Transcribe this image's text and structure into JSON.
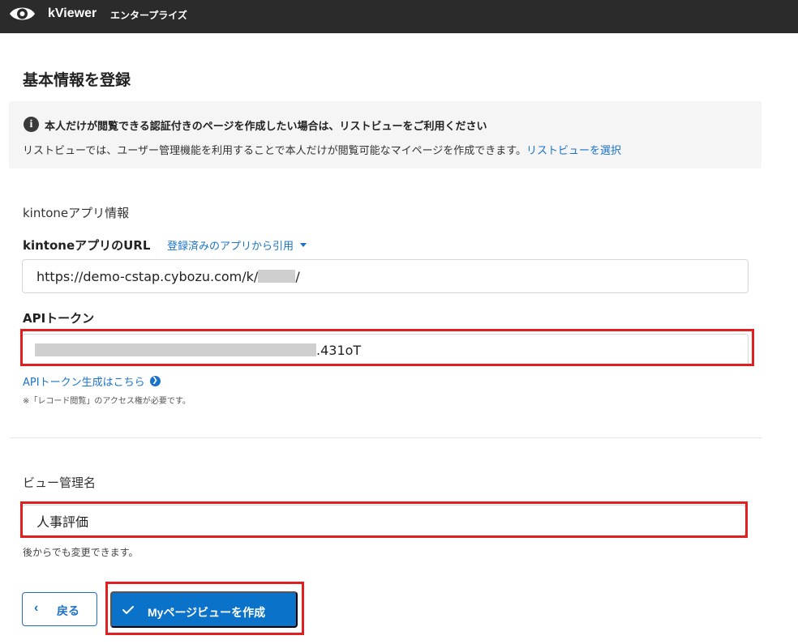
{
  "app": {
    "name": "kViewer",
    "edition": "エンタープライズ"
  },
  "page": {
    "title": "基本情報を登録"
  },
  "notice": {
    "title": "本人だけが閲覧できる認証付きのページを作成したい場合は、リストビューをご利用ください",
    "body": "リストビューでは、ユーザー管理機能を利用することで本人だけが閲覧可能なマイページを作成できます。",
    "link": "リストビューを選択"
  },
  "kintone": {
    "section_label": "kintoneアプリ情報",
    "url_label": "kintoneアプリのURL",
    "url_link": "登録済みのアプリから引用",
    "url_value_prefix": "https://demo-cstap.cybozu.com/k/",
    "url_value_suffix": "/",
    "token_label": "APIトークン",
    "token_value_suffix": ".431oT",
    "token_link": "APIトークン生成はこちら",
    "token_note": "※「レコード閲覧」のアクセス権が必要です。"
  },
  "view": {
    "label": "ビュー管理名",
    "value": "人事評価",
    "note": "後からでも変更できます。"
  },
  "actions": {
    "back_label": "戻る",
    "create_label": "Myページビューを作成"
  },
  "colors": {
    "topbar": "#2b2b2b",
    "accent": "#1a73c8",
    "primary_button": "#0b72c9",
    "highlight": "#e02020"
  },
  "icons": {
    "logo": "eye-icon",
    "notice": "info-icon",
    "dropdown": "caret-down-icon",
    "token_link": "arrow-circle-right-icon",
    "back": "chevron-left-icon",
    "create": "check-icon"
  }
}
